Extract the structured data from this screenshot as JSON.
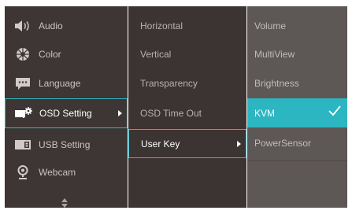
{
  "menu1": {
    "items": [
      {
        "label": "Audio",
        "icon": "speaker-icon"
      },
      {
        "label": "Color",
        "icon": "color-wheel-icon"
      },
      {
        "label": "Language",
        "icon": "language-icon"
      },
      {
        "label": "OSD Setting",
        "icon": "osd-setting-icon",
        "selected": true
      },
      {
        "label": "USB Setting",
        "icon": "usb-setting-icon"
      },
      {
        "label": "Webcam",
        "icon": "webcam-icon"
      }
    ],
    "scroll_icon": "up-down-icon"
  },
  "menu2": {
    "items": [
      {
        "label": "Horizontal"
      },
      {
        "label": "Vertical"
      },
      {
        "label": "Transparency"
      },
      {
        "label": "OSD Time Out"
      },
      {
        "label": "User Key",
        "selected": true
      }
    ]
  },
  "menu3": {
    "items": [
      {
        "label": "Volume"
      },
      {
        "label": "MultiView"
      },
      {
        "label": "Brightness"
      },
      {
        "label": "KVM",
        "checked": true
      },
      {
        "label": "PowerSensor"
      }
    ]
  },
  "colors": {
    "accent": "#2cb6c2",
    "panel": "#3d3634",
    "panel_light": "#5d5755"
  }
}
